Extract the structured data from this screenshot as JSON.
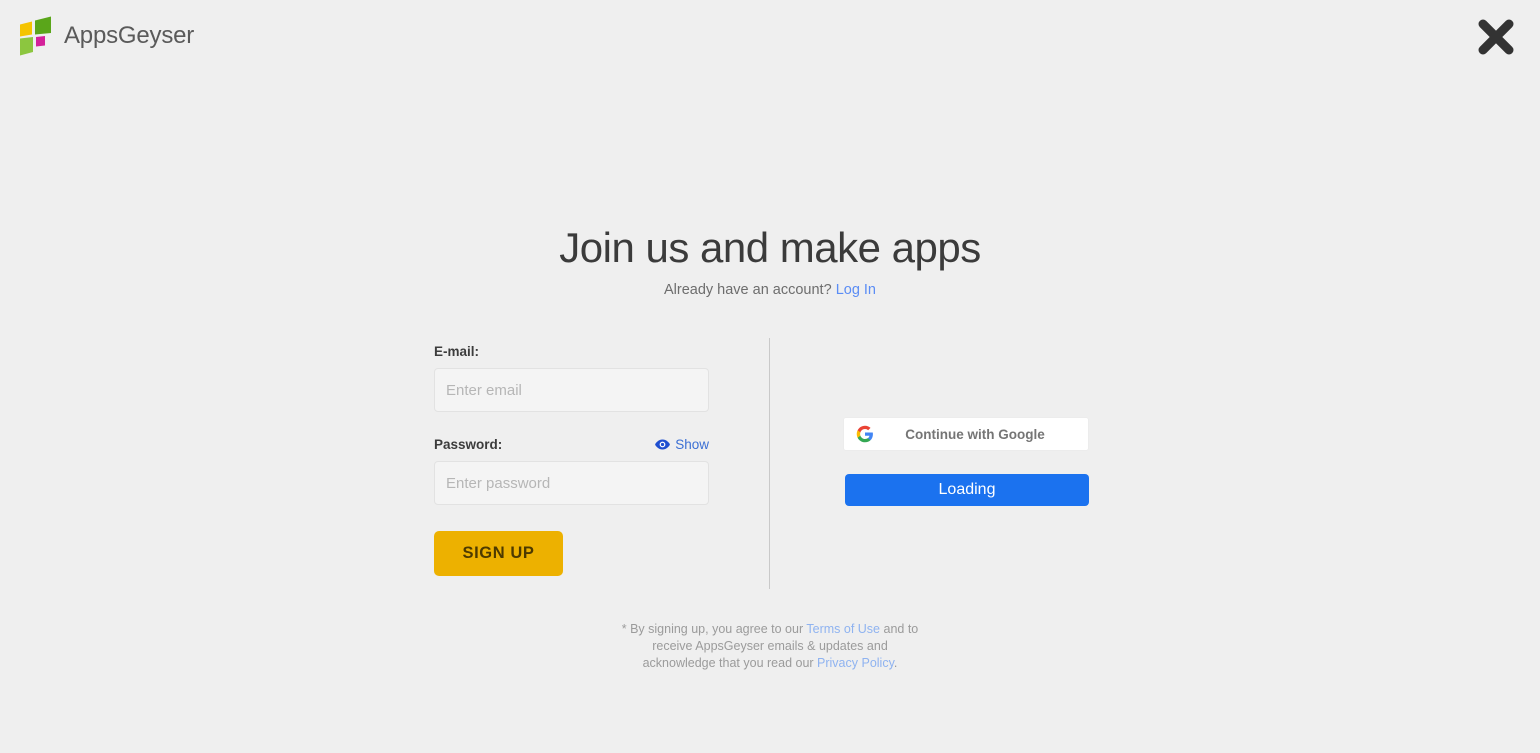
{
  "header": {
    "brand_name": "AppsGeyser",
    "logo_icon": "appsgeyser-logo-icon",
    "close_icon": "close-x-icon",
    "logo_colors": {
      "yellow": "#f5c400",
      "dark_green": "#5aa61a",
      "light_green": "#8cc63f",
      "magenta": "#d4219a"
    }
  },
  "main": {
    "title": "Join us and make apps",
    "subtitle_text": "Already have an account?",
    "login_link": "Log In"
  },
  "form": {
    "email": {
      "label": "E-mail:",
      "placeholder": "Enter email",
      "value": ""
    },
    "password": {
      "label": "Password:",
      "placeholder": "Enter password",
      "value": "",
      "show_label": "Show",
      "show_icon": "eye-icon"
    },
    "submit_label": "SIGN UP",
    "submit_color": "#edb100"
  },
  "social": {
    "google_label": "Continue with Google",
    "google_icon": "google-g-icon",
    "loading_label": "Loading",
    "loading_color": "#1b72ef"
  },
  "terms": {
    "part1": "* By signing up, you agree to our ",
    "terms_link": "Terms of Use",
    "part2": " and to receive AppsGeyser emails & updates and acknowledge that you read our ",
    "privacy_link": "Privacy Policy",
    "part3": "."
  },
  "colors": {
    "background": "#efefef",
    "link": "#5b8df5",
    "text": "#3b3b3b"
  }
}
